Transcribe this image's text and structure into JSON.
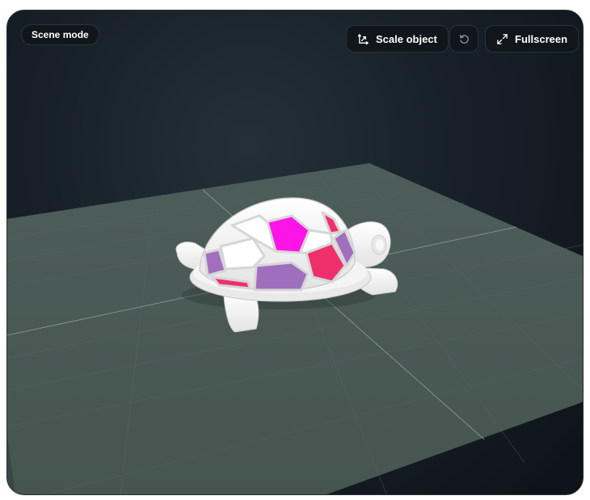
{
  "viewer": {
    "mode_label": "Scene mode",
    "scale_label": "Scale object",
    "fullscreen_label": "Fullscreen",
    "icons": {
      "scale": "scale-arrows-icon",
      "reset": "rotate-reset-icon",
      "fullscreen": "expand-icon"
    }
  },
  "scene": {
    "object": "turtle-model",
    "colors": {
      "floor": "#4b5b58",
      "grid": "#5d6e6a",
      "shell_white": "#f4f4f4",
      "magenta": "#ff14e8",
      "pink": "#f0306a",
      "purple": "#9f6fbd"
    }
  }
}
